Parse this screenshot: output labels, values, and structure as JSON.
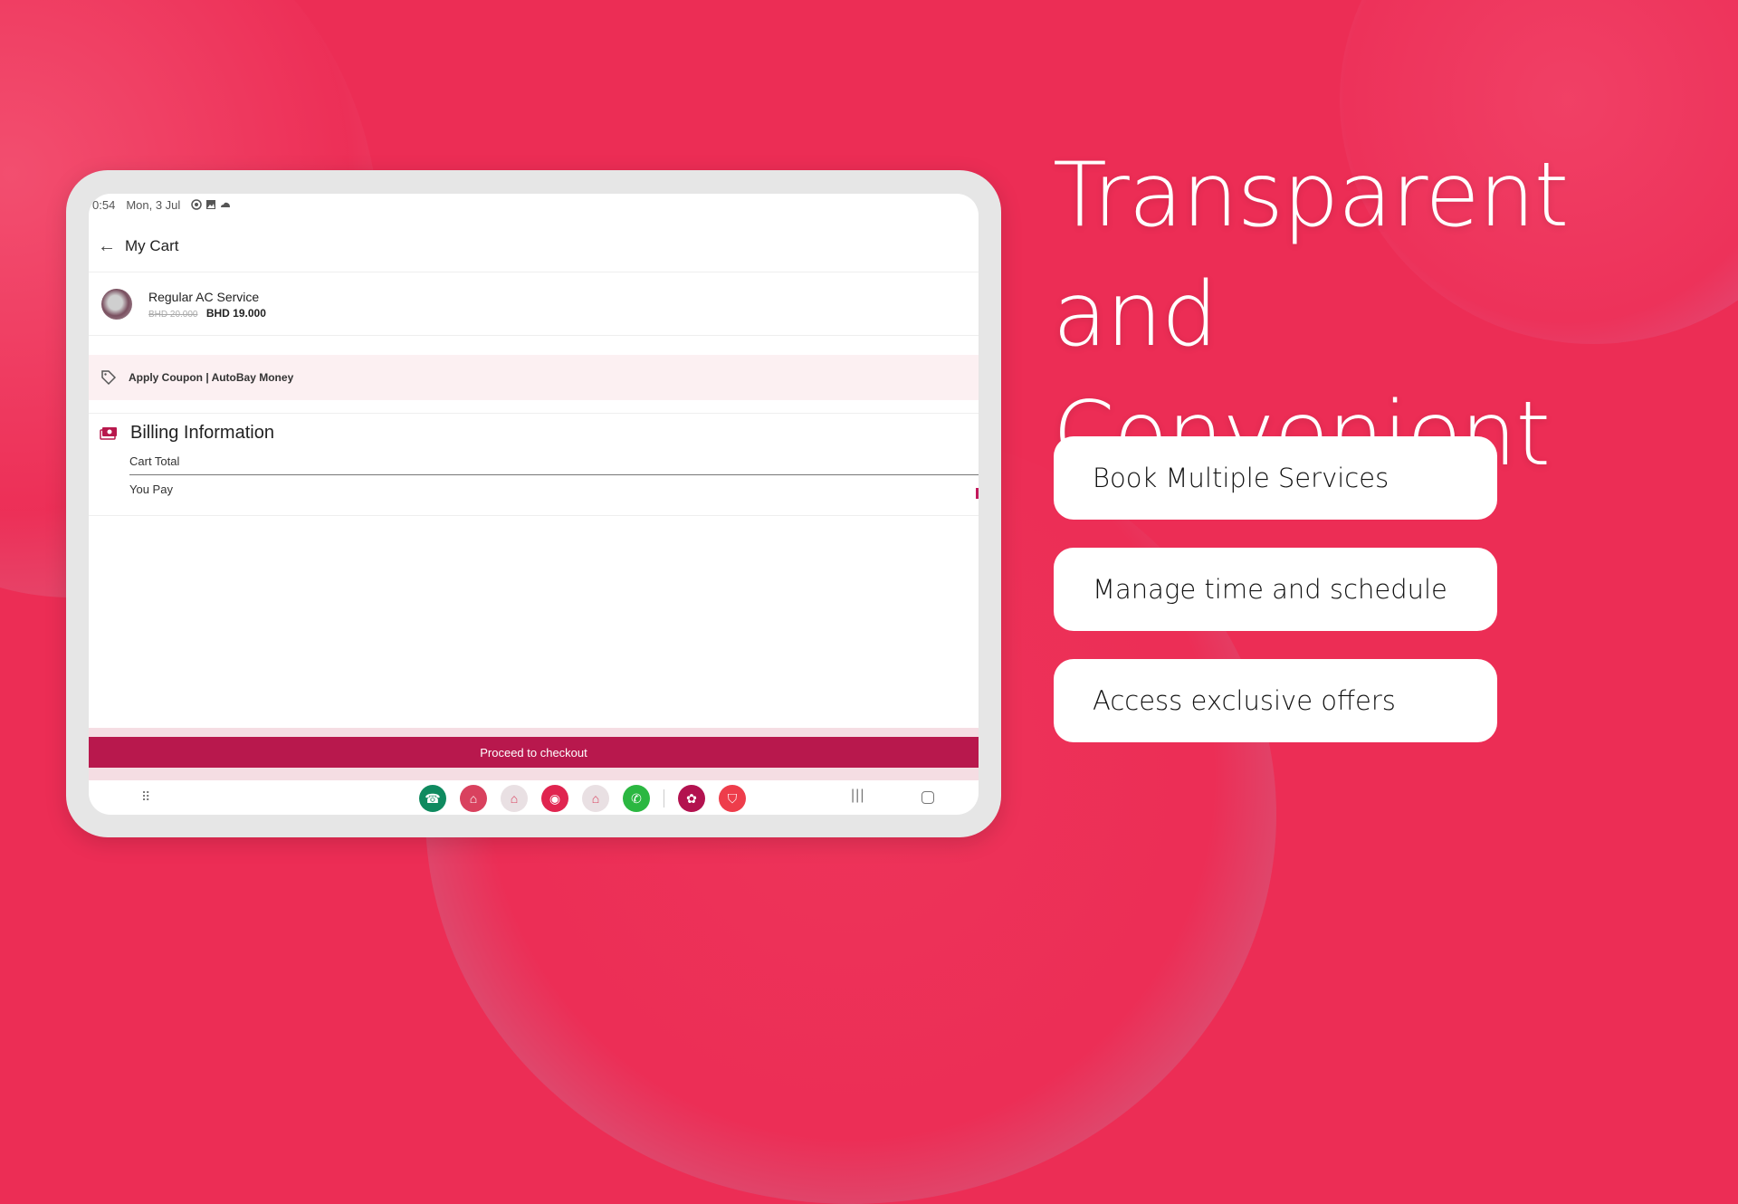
{
  "status_bar": {
    "time": "0:54",
    "date": "Mon, 3 Jul",
    "icons": [
      "sync-icon",
      "gallery-icon",
      "cloud-icon"
    ]
  },
  "app": {
    "title": "My Cart",
    "back_icon": "arrow-left-icon",
    "cart_item": {
      "name": "Regular AC Service",
      "original_price": "BHD 20.000",
      "price": "BHD 19.000"
    },
    "coupon": {
      "icon": "tag-icon",
      "label": "Apply Coupon | AutoBay Money"
    },
    "billing": {
      "icon": "cash-icon",
      "title": "Billing Information",
      "rows": [
        "Cart Total",
        "You Pay"
      ]
    },
    "checkout_label": "Proceed to checkout",
    "brand_color": "#b8184d"
  },
  "nav": {
    "apps": [
      {
        "name": "phone",
        "color": "#0f8a5f",
        "glyph": "☎"
      },
      {
        "name": "autobay",
        "color": "#d9415e",
        "glyph": "⌂"
      },
      {
        "name": "autobay-messenger",
        "color": "#e9e0e3",
        "glyph": "⌂"
      },
      {
        "name": "camera",
        "color": "#e0244f",
        "glyph": "◉"
      },
      {
        "name": "autobay-chrome",
        "color": "#e9e0e3",
        "glyph": "⌂"
      },
      {
        "name": "whatsapp",
        "color": "#2bb741",
        "glyph": "✆"
      },
      {
        "name": "gallery",
        "color": "#b3124f",
        "glyph": "✿"
      },
      {
        "name": "store",
        "color": "#ee3d4b",
        "glyph": "⛉"
      }
    ],
    "recents_glyph": "|||"
  },
  "hero": {
    "line1": "Transparent",
    "line2": "and Convenient"
  },
  "features": [
    "Book Multiple Services",
    "Manage time and schedule",
    "Access exclusive offers"
  ],
  "background_color": "#ec2d55"
}
